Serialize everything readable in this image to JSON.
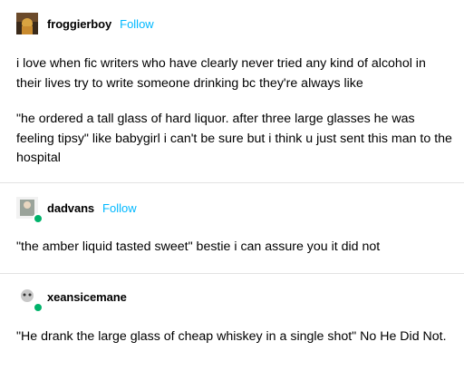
{
  "posts": [
    {
      "username": "froggierboy",
      "follow_label": "Follow",
      "paragraphs": [
        "i love when fic writers who have clearly never tried any kind of alcohol in their lives try to write someone drinking bc they're always like",
        "\"he ordered a tall glass of hard liquor.  after three large glasses he was feeling tipsy\" like babygirl i can't be sure but i think u just sent this man to the hospital"
      ]
    },
    {
      "username": "dadvans",
      "follow_label": "Follow",
      "paragraphs": [
        "\"the amber liquid tasted sweet\" bestie i can assure you it did not"
      ]
    },
    {
      "username": "xeansicemane",
      "paragraphs": [
        "\"He drank the large glass of cheap whiskey in a single shot\" No He Did Not."
      ]
    }
  ],
  "colors": {
    "follow": "#00b8ff",
    "badge": "#00b36b",
    "divider": "#e2e2e2"
  }
}
